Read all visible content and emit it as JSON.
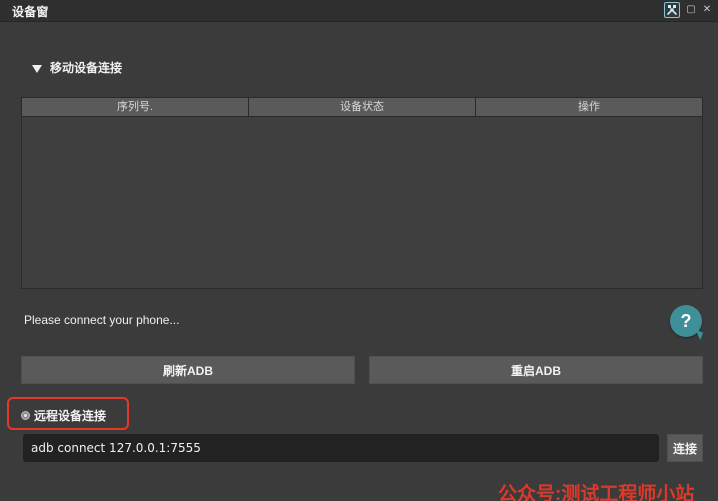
{
  "window": {
    "title": "设备窗",
    "controls": {
      "tools_icon": "tools-icon",
      "float_icon": "float-icon",
      "close_icon": "close-icon"
    }
  },
  "mobile_section": {
    "expanded_icon": "triangle-down-icon",
    "label": "移动设备连接"
  },
  "device_table": {
    "headers": [
      "序列号.",
      "设备状态",
      "操作"
    ],
    "rows": []
  },
  "status": {
    "message": "Please connect your phone...",
    "help_icon": "help-icon",
    "help_text": "?"
  },
  "buttons": {
    "refresh_label": "刷新ADB",
    "restart_label": "重启ADB",
    "connect_label": "连接"
  },
  "remote_section": {
    "label": "远程设备连接",
    "input_value": "adb connect 127.0.0.1:7555",
    "highlight_color": "#e2392a"
  },
  "watermark": {
    "text": "公众号:测试工程师小站",
    "color": "#e33a2b"
  },
  "colors": {
    "background": "#3b3b3b",
    "header": "#5a5a5a",
    "accent": "#3e8f98"
  }
}
